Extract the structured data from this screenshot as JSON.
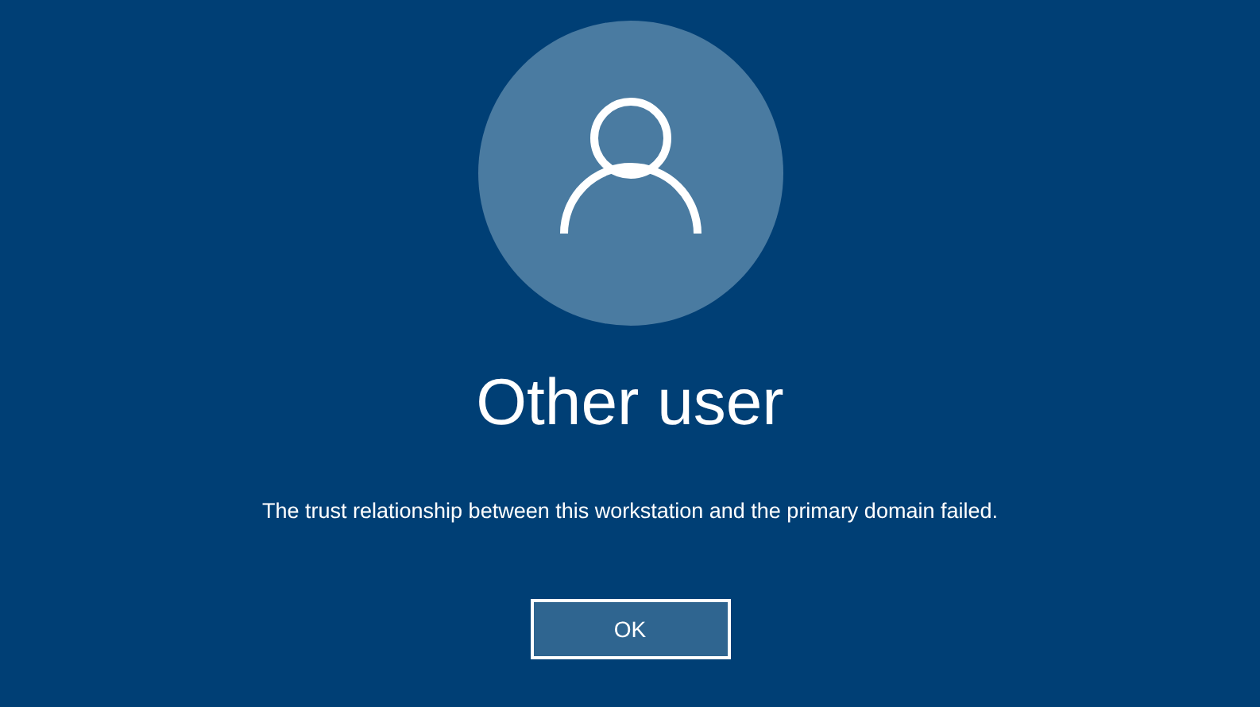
{
  "user": {
    "name": "Other user"
  },
  "message": "The trust relationship between this workstation and the primary domain failed.",
  "buttons": [
    {
      "label": "OK"
    }
  ]
}
